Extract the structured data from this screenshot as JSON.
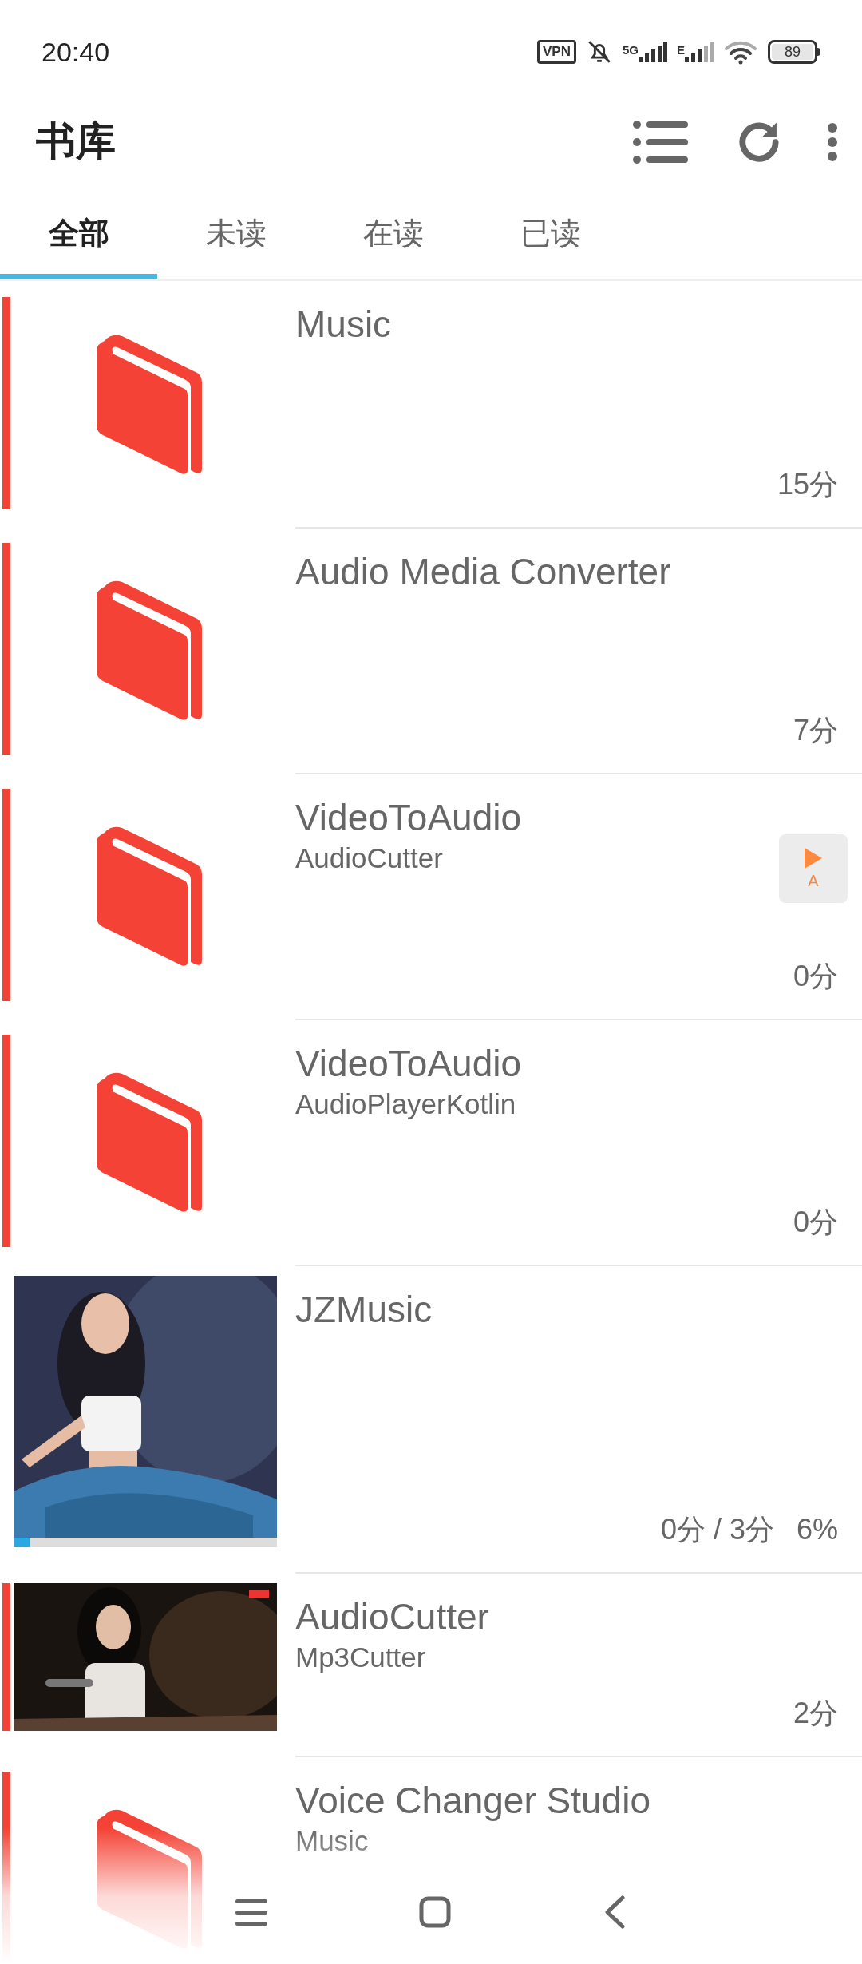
{
  "status_bar": {
    "time": "20:40",
    "vpn": "VPN",
    "network_1": "5G",
    "network_2": "E",
    "battery": "89"
  },
  "toolbar": {
    "title": "书库"
  },
  "tabs": [
    {
      "label": "全部",
      "selected": true
    },
    {
      "label": "未读",
      "selected": false
    },
    {
      "label": "在读",
      "selected": false
    },
    {
      "label": "已读",
      "selected": false
    }
  ],
  "books": [
    {
      "kind": "book",
      "marked": true,
      "title": "Music",
      "time": "15分"
    },
    {
      "kind": "book",
      "marked": true,
      "title": "Audio Media Converter",
      "time": "7分"
    },
    {
      "kind": "book",
      "marked": true,
      "title": "VideoToAudio",
      "subtitle": "AudioCutter",
      "time": "0分",
      "play_badge": "A"
    },
    {
      "kind": "book",
      "marked": true,
      "title": "VideoToAudio",
      "subtitle": "AudioPlayerKotlin",
      "time": "0分"
    },
    {
      "kind": "picture",
      "marked": false,
      "title": "JZMusic",
      "time": "0分 / 3分",
      "percent": "6%",
      "level": 0.06
    },
    {
      "kind": "picture",
      "marked": true,
      "title": "AudioCutter",
      "subtitle": "Mp3Cutter",
      "time": "2分"
    },
    {
      "kind": "book",
      "marked": true,
      "title": "Voice Changer Studio",
      "subtitle": "Music"
    }
  ]
}
